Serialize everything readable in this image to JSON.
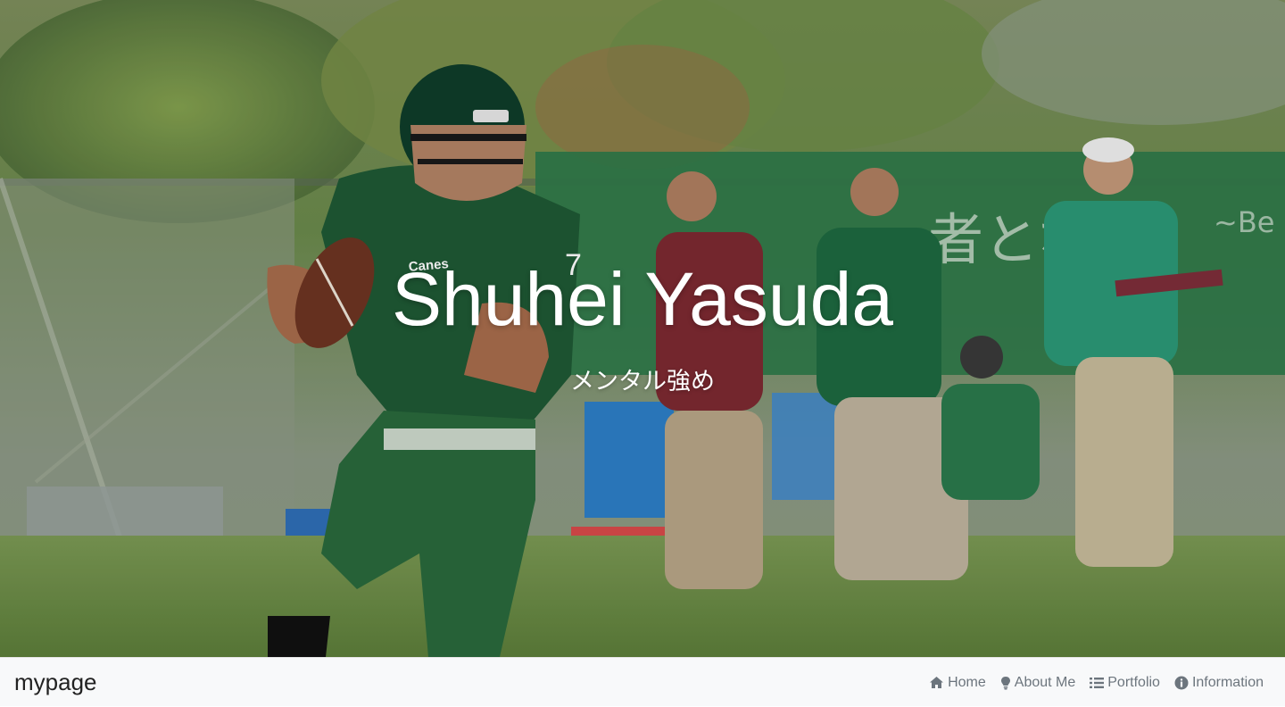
{
  "hero": {
    "title": "Shuhei Yasuda",
    "subtitle": "メンタル強め"
  },
  "navbar": {
    "brand": "mypage",
    "items": [
      {
        "label": "Home",
        "icon": "home-icon"
      },
      {
        "label": "About Me",
        "icon": "lightbulb-icon"
      },
      {
        "label": "Portfolio",
        "icon": "list-icon"
      },
      {
        "label": "Information",
        "icon": "info-circle-icon"
      }
    ]
  },
  "colors": {
    "navbar_bg": "#f8f9fa",
    "nav_text": "#6c757d",
    "brand_text": "#222222",
    "hero_text": "#ffffff"
  }
}
